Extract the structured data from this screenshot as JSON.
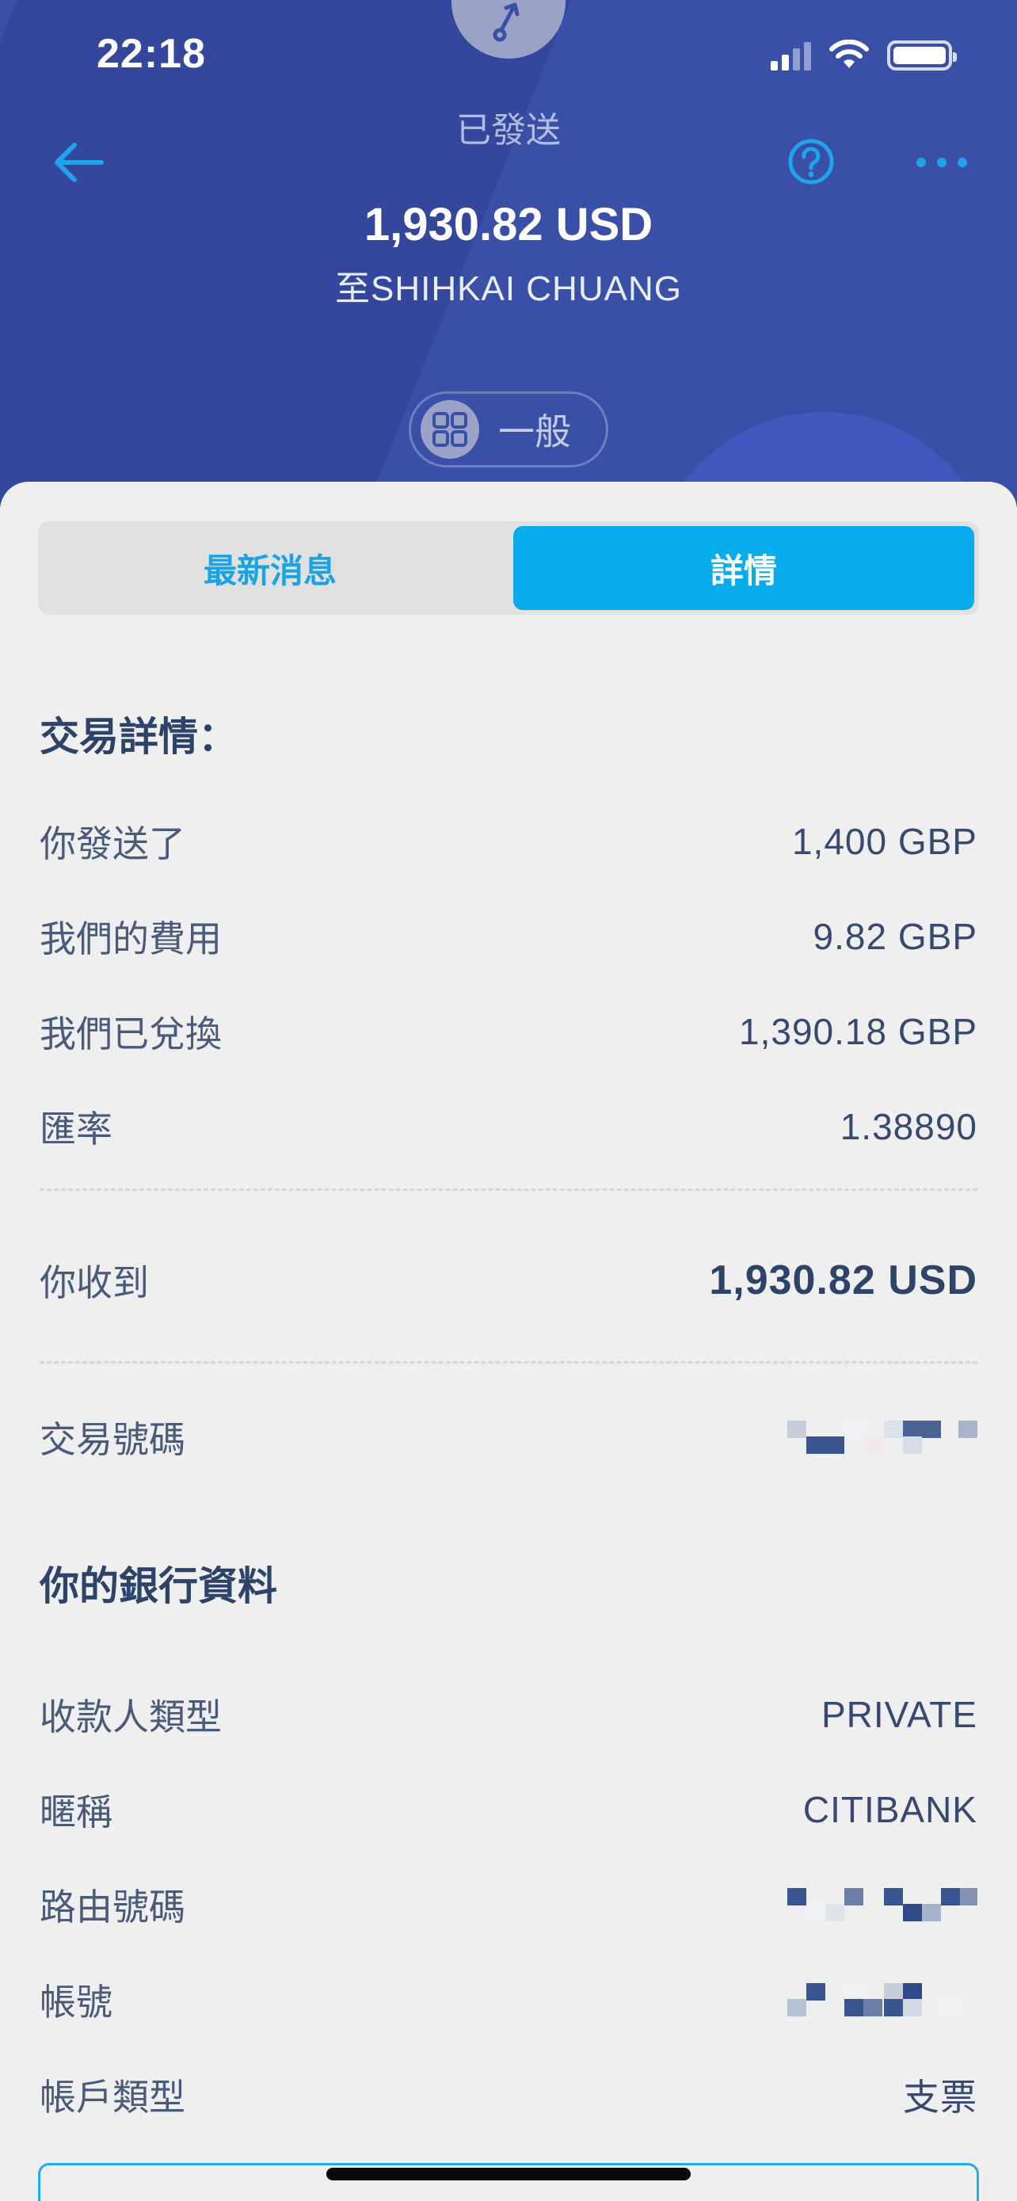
{
  "status_bar": {
    "time": "22:18"
  },
  "header": {
    "status_label": "已發送",
    "amount": "1,930.82 USD",
    "recipient": "至SHIHKAI CHUANG",
    "category": "一般"
  },
  "tabs": [
    {
      "label": "最新消息",
      "active": false
    },
    {
      "label": "詳情",
      "active": true
    }
  ],
  "transaction": {
    "title": "交易詳情：",
    "rows": [
      {
        "label": "你發送了",
        "value": "1,400 GBP"
      },
      {
        "label": "我們的費用",
        "value": "9.82 GBP"
      },
      {
        "label": "我們已兌換",
        "value": "1,390.18 GBP"
      },
      {
        "label": "匯率",
        "value": "1.38890"
      }
    ],
    "received": {
      "label": "你收到",
      "value": "1,930.82 USD"
    },
    "reference": {
      "label": "交易號碼"
    }
  },
  "bank": {
    "title": "你的銀行資料",
    "rows": [
      {
        "label": "收款人類型",
        "value": "PRIVATE"
      },
      {
        "label": "暱稱",
        "value": "CITIBANK"
      },
      {
        "label": "路由號碼"
      },
      {
        "label": "帳號"
      },
      {
        "label": "帳戶類型",
        "value": "支票"
      }
    ]
  },
  "colors": {
    "header_bg": "#3a4fa6",
    "accent": "#08acec",
    "text_primary": "#2e4369"
  },
  "icons": [
    "back-arrow-icon",
    "help-icon",
    "more-icon",
    "send-arrow-icon",
    "grid-category-icon",
    "wifi-icon",
    "signal-icon",
    "battery-icon"
  ]
}
